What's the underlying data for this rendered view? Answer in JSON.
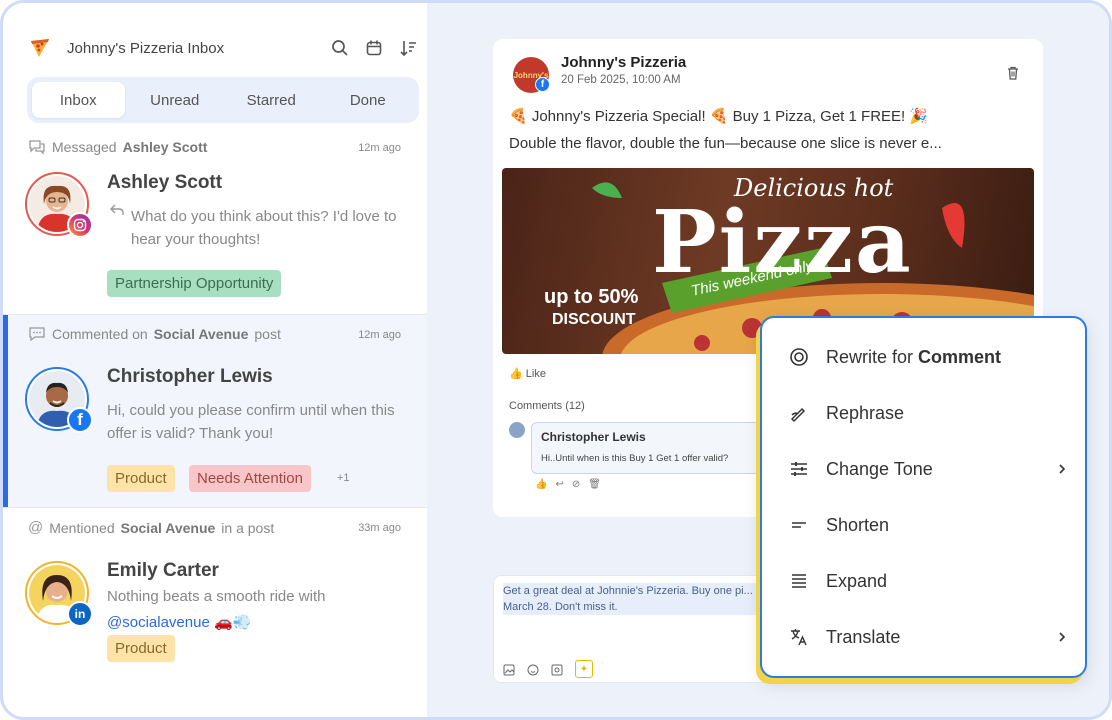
{
  "inbox": {
    "title": "Johnny's Pizzeria Inbox",
    "tabs": [
      "Inbox",
      "Unread",
      "Starred",
      "Done"
    ],
    "active_tab": "Inbox"
  },
  "conversations": [
    {
      "meta_action": "Messaged",
      "meta_target": "Ashley Scott",
      "meta_suffix": "",
      "time": "12m ago",
      "name": "Ashley Scott",
      "message": "What do you think about this? I'd love to hear your thoughts!",
      "channel": "instagram",
      "tags": [
        "Partnership Opportunity"
      ]
    },
    {
      "meta_action": "Commented on",
      "meta_target": "Social Avenue",
      "meta_suffix": "post",
      "time": "12m ago",
      "name": "Christopher Lewis",
      "message": "Hi, could you please confirm until when this offer is valid? Thank you!",
      "channel": "facebook",
      "tags": [
        "Product",
        "Needs Attention"
      ],
      "more_tags": "+1"
    },
    {
      "meta_action": "Mentioned",
      "meta_target": "Social Avenue",
      "meta_suffix": "in a post",
      "time": "33m ago",
      "name": "Emily Carter",
      "message": "Nothing beats a smooth ride with",
      "mention": "@socialavenue 🚗💨",
      "channel": "linkedin",
      "tags": [
        "Product"
      ]
    }
  ],
  "post": {
    "author": "Johnny's Pizzeria",
    "avatar_text": "Johnny's",
    "date": "20 Feb 2025, 10:00 AM",
    "line1": "🍕 Johnny's Pizzeria Special! 🍕 Buy 1 Pizza, Get 1 FREE! 🎉",
    "line2": "Double the flavor, double the fun—because one slice is never e...",
    "image": {
      "headline": "Pizza",
      "script": "Delicious hot",
      "ribbon": "This weekend only",
      "discount_line1": "up to 50%",
      "discount_line2": "DISCOUNT"
    },
    "like_label": "Like",
    "comments_label": "Comments (12)",
    "comment": {
      "author": "Christopher Lewis",
      "text": "Hi..Until when is this Buy 1 Get 1 offer valid?"
    }
  },
  "reply": {
    "text": "Get a great deal at Johnnie's Pizzeria. Buy one pi... March 28. Don't miss it."
  },
  "ai_menu": {
    "items": [
      {
        "icon": "rewrite-icon",
        "label": "Rewrite for ",
        "bold": "Comment",
        "submenu": false
      },
      {
        "icon": "rephrase-icon",
        "label": "Rephrase",
        "bold": "",
        "submenu": false
      },
      {
        "icon": "tone-icon",
        "label": "Change Tone",
        "bold": "",
        "submenu": true
      },
      {
        "icon": "shorten-icon",
        "label": "Shorten",
        "bold": "",
        "submenu": false
      },
      {
        "icon": "expand-icon",
        "label": "Expand",
        "bold": "",
        "submenu": false
      },
      {
        "icon": "translate-icon",
        "label": "Translate",
        "bold": "",
        "submenu": true
      }
    ]
  },
  "colors": {
    "accent": "#2b6ae0",
    "tag_green": "#a7dfc0",
    "tag_orange": "#fde3a8",
    "tag_red": "#f8c6c6",
    "menu_border": "#2b7be4",
    "menu_shadow": "#f0d44a"
  }
}
